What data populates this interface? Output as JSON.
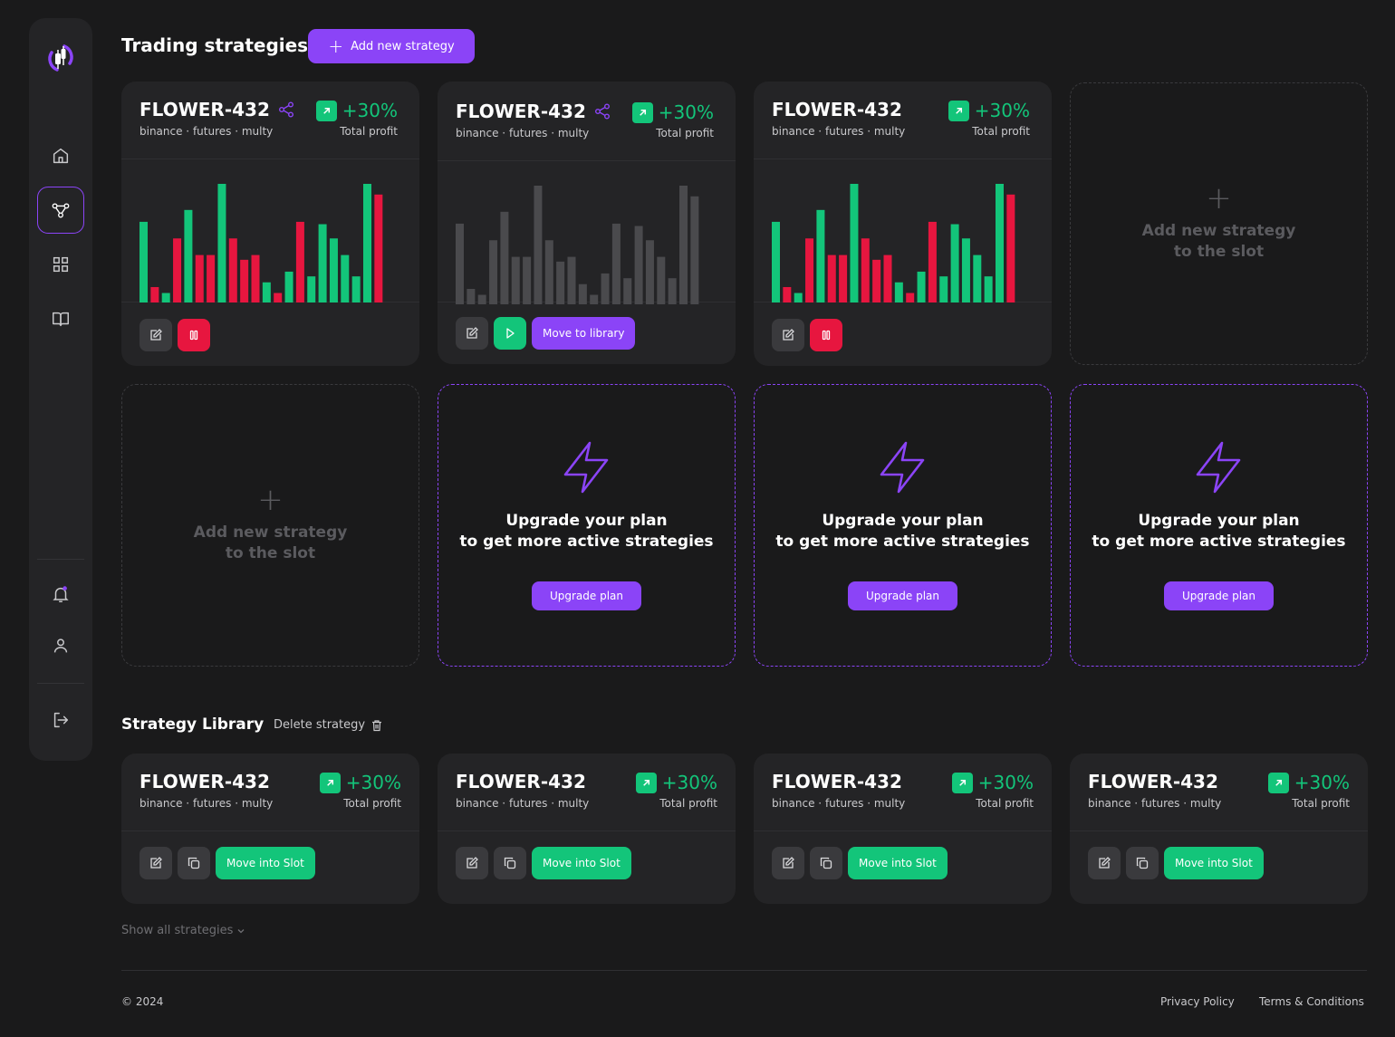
{
  "colors": {
    "accent": "#8b44f7",
    "up": "#13c57a",
    "down": "#e7163f",
    "neutral": "#4a4a4d",
    "bg": "#1a1a1b",
    "card": "#242426"
  },
  "header": {
    "title": "Trading strategies",
    "add_label": "Add new strategy"
  },
  "active_strategies": [
    {
      "name": "FLOWER-432",
      "meta": "binance · futures · multy",
      "profit": "+30%",
      "profit_label": "Total profit",
      "shared": true,
      "state": "running",
      "bars": [
        {
          "v": 0.68,
          "up": true
        },
        {
          "v": 0.13,
          "up": false
        },
        {
          "v": 0.08,
          "up": true
        },
        {
          "v": 0.54,
          "up": false
        },
        {
          "v": 0.78,
          "up": true
        },
        {
          "v": 0.4,
          "up": false
        },
        {
          "v": 0.4,
          "up": false
        },
        {
          "v": 1.0,
          "up": true
        },
        {
          "v": 0.54,
          "up": false
        },
        {
          "v": 0.36,
          "up": false
        },
        {
          "v": 0.4,
          "up": false
        },
        {
          "v": 0.17,
          "up": true
        },
        {
          "v": 0.08,
          "up": false
        },
        {
          "v": 0.26,
          "up": true
        },
        {
          "v": 0.68,
          "up": false
        },
        {
          "v": 0.22,
          "up": true
        },
        {
          "v": 0.66,
          "up": true
        },
        {
          "v": 0.54,
          "up": true
        },
        {
          "v": 0.4,
          "up": true
        },
        {
          "v": 0.22,
          "up": true
        },
        {
          "v": 1.0,
          "up": true
        },
        {
          "v": 0.91,
          "up": false
        }
      ]
    },
    {
      "name": "FLOWER-432",
      "meta": "binance · futures · multy",
      "profit": "+30%",
      "profit_label": "Total profit",
      "shared": true,
      "state": "stopped",
      "move_label": "Move to library",
      "bars": [
        {
          "v": 0.68,
          "up": true
        },
        {
          "v": 0.13,
          "up": false
        },
        {
          "v": 0.08,
          "up": true
        },
        {
          "v": 0.54,
          "up": false
        },
        {
          "v": 0.78,
          "up": true
        },
        {
          "v": 0.4,
          "up": false
        },
        {
          "v": 0.4,
          "up": false
        },
        {
          "v": 1.0,
          "up": true
        },
        {
          "v": 0.54,
          "up": false
        },
        {
          "v": 0.36,
          "up": false
        },
        {
          "v": 0.4,
          "up": false
        },
        {
          "v": 0.17,
          "up": true
        },
        {
          "v": 0.08,
          "up": false
        },
        {
          "v": 0.26,
          "up": true
        },
        {
          "v": 0.68,
          "up": false
        },
        {
          "v": 0.22,
          "up": true
        },
        {
          "v": 0.66,
          "up": true
        },
        {
          "v": 0.54,
          "up": true
        },
        {
          "v": 0.4,
          "up": true
        },
        {
          "v": 0.22,
          "up": true
        },
        {
          "v": 1.0,
          "up": true
        },
        {
          "v": 0.91,
          "up": false
        }
      ]
    },
    {
      "name": "FLOWER-432",
      "meta": "binance · futures · multy",
      "profit": "+30%",
      "profit_label": "Total profit",
      "shared": false,
      "state": "running",
      "bars": [
        {
          "v": 0.68,
          "up": true
        },
        {
          "v": 0.13,
          "up": false
        },
        {
          "v": 0.08,
          "up": true
        },
        {
          "v": 0.54,
          "up": false
        },
        {
          "v": 0.78,
          "up": true
        },
        {
          "v": 0.4,
          "up": false
        },
        {
          "v": 0.4,
          "up": false
        },
        {
          "v": 1.0,
          "up": true
        },
        {
          "v": 0.54,
          "up": false
        },
        {
          "v": 0.36,
          "up": false
        },
        {
          "v": 0.4,
          "up": false
        },
        {
          "v": 0.17,
          "up": true
        },
        {
          "v": 0.08,
          "up": false
        },
        {
          "v": 0.26,
          "up": true
        },
        {
          "v": 0.68,
          "up": false
        },
        {
          "v": 0.22,
          "up": true
        },
        {
          "v": 0.66,
          "up": true
        },
        {
          "v": 0.54,
          "up": true
        },
        {
          "v": 0.4,
          "up": true
        },
        {
          "v": 0.22,
          "up": true
        },
        {
          "v": 1.0,
          "up": true
        },
        {
          "v": 0.91,
          "up": false
        }
      ]
    }
  ],
  "empty_slot": {
    "line1": "Add new strategy",
    "line2": "to the slot"
  },
  "upgrade_slot": {
    "line1": "Upgrade your plan",
    "line2": "to get more active strategies",
    "button": "Upgrade plan"
  },
  "library": {
    "title": "Strategy Library",
    "delete_label": "Delete strategy",
    "items": [
      {
        "name": "FLOWER-432",
        "meta": "binance · futures · multy",
        "profit": "+30%",
        "profit_label": "Total profit",
        "move_label": "Move into Slot"
      },
      {
        "name": "FLOWER-432",
        "meta": "binance · futures · multy",
        "profit": "+30%",
        "profit_label": "Total profit",
        "move_label": "Move into Slot"
      },
      {
        "name": "FLOWER-432",
        "meta": "binance · futures · multy",
        "profit": "+30%",
        "profit_label": "Total profit",
        "move_label": "Move into Slot"
      },
      {
        "name": "FLOWER-432",
        "meta": "binance · futures · multy",
        "profit": "+30%",
        "profit_label": "Total profit",
        "move_label": "Move into Slot"
      }
    ],
    "show_all": "Show all strategies"
  },
  "footer": {
    "copyright": "© 2024",
    "privacy": "Privacy Policy",
    "terms": "Terms & Conditions"
  }
}
